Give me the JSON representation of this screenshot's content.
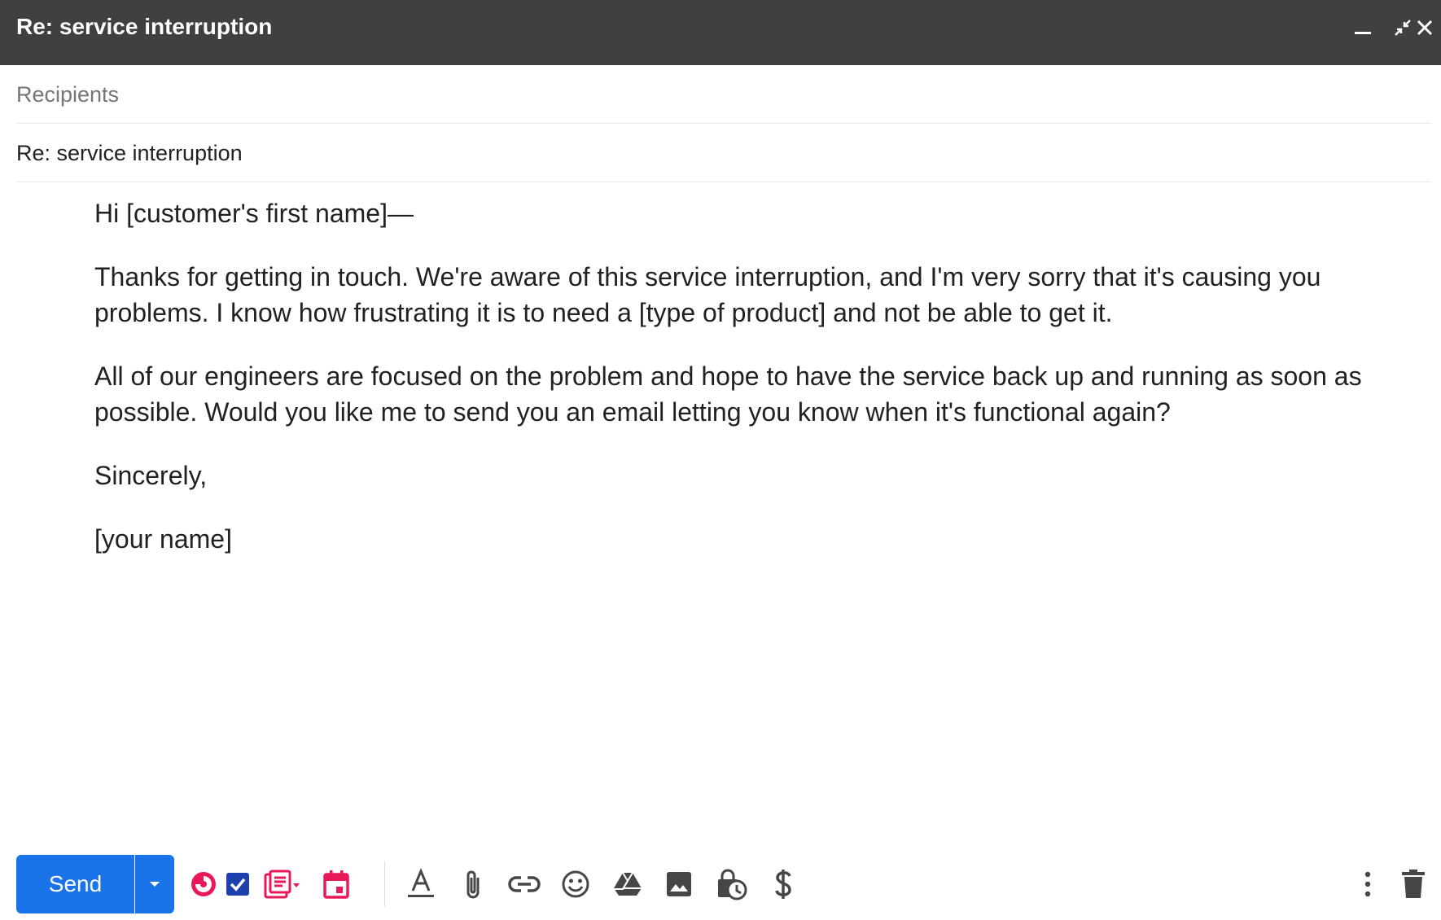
{
  "window": {
    "title": "Re: service interruption"
  },
  "header": {
    "recipients_placeholder": "Recipients",
    "subject_value": "Re: service interruption"
  },
  "body": {
    "greeting": "Hi [customer's first name]—",
    "paragraph1": "Thanks for getting in touch. We're aware of this service interruption, and I'm very sorry that it's causing you problems. I know how frustrating it is to need a [type of product] and not be able to get it.",
    "paragraph2": "All of our engineers are focused on the problem and hope to have the service back up and running as soon as possible. Would you like me to send you an email letting you know when it's functional again?",
    "closing": "Sincerely,",
    "signature": "[your name]"
  },
  "toolbar": {
    "send_label": "Send",
    "icons": [
      "minimize-icon",
      "exit-fullscreen-icon",
      "close-icon",
      "send-options-icon",
      "pie-timer-icon",
      "checkbox-task-icon",
      "templates-icon",
      "calendar-icon",
      "text-format-icon",
      "attach-icon",
      "link-icon",
      "emoji-icon",
      "drive-icon",
      "photo-icon",
      "confidential-mode-icon",
      "dollar-icon",
      "more-options-icon",
      "delete-icon"
    ]
  },
  "colors": {
    "titlebar": "#404040",
    "send_button": "#1a73e8",
    "pink_addon": "#e8185a",
    "blue_addon": "#1e3fae",
    "toolbar_icon": "#444746"
  }
}
